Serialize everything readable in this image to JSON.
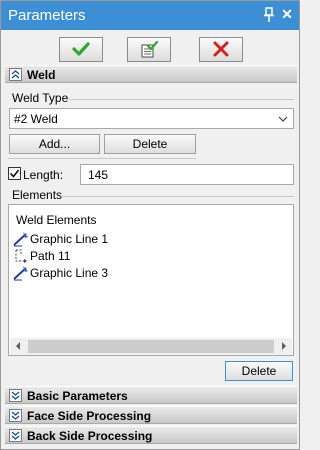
{
  "window": {
    "title": "Parameters"
  },
  "toolbar": {
    "ok_icon": "checkmark-icon",
    "apply_icon": "apply-icon",
    "cancel_icon": "cancel-x-icon"
  },
  "weld_section": {
    "header": "Weld",
    "weld_type_label": "Weld Type",
    "weld_type_value": "#2 Weld",
    "add_button": "Add...",
    "delete_button": "Delete",
    "length_label": "Length:",
    "length_checked": true,
    "length_value": "145",
    "elements_label": "Elements",
    "elements_header": "Weld Elements",
    "elements": [
      {
        "label": "Graphic Line 1",
        "icon": "graphic-line-icon"
      },
      {
        "label": "Path 11",
        "icon": "path-icon"
      },
      {
        "label": "Graphic Line 3",
        "icon": "graphic-line-icon"
      }
    ],
    "elements_delete_button": "Delete"
  },
  "collapsed_sections": [
    {
      "header": "Basic Parameters"
    },
    {
      "header": "Face Side Processing"
    },
    {
      "header": "Back Side Processing"
    }
  ],
  "colors": {
    "title_bar": "#3c8fd4",
    "ok_green": "#2fa82f",
    "cancel_red": "#d42020"
  }
}
